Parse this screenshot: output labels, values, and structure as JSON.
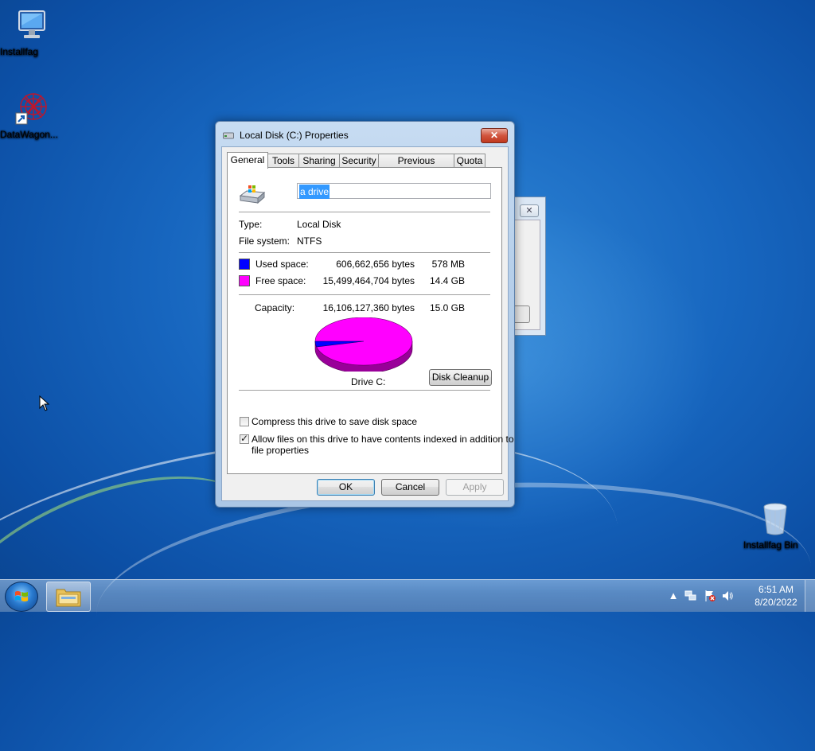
{
  "desktop": {
    "icons": [
      {
        "label": "Installfag",
        "icon": "computer-monitor-icon"
      },
      {
        "label": "DataWagon...",
        "icon": "shortcut-app-icon"
      },
      {
        "label": "Installfag Bin",
        "icon": "recycle-bin-icon"
      }
    ]
  },
  "dialog": {
    "title": "Local Disk (C:) Properties",
    "close_label": "✕",
    "tabs": [
      "General",
      "Tools",
      "Sharing",
      "Security",
      "Previous Versions",
      "Quota"
    ],
    "active_tab": "General",
    "drive_name": "a drive",
    "type_label": "Type:",
    "type_value": "Local Disk",
    "fs_label": "File system:",
    "fs_value": "NTFS",
    "used": {
      "label": "Used space:",
      "bytes": "606,662,656 bytes",
      "size": "578 MB",
      "color": "#0000ff"
    },
    "free": {
      "label": "Free space:",
      "bytes": "15,499,464,704 bytes",
      "size": "14.4 GB",
      "color": "#ff00ff"
    },
    "capacity": {
      "label": "Capacity:",
      "bytes": "16,106,127,360 bytes",
      "size": "15.0 GB"
    },
    "drive_caption": "Drive C:",
    "disk_cleanup_label": "Disk Cleanup",
    "compress_label": "Compress this drive to save disk space",
    "compress_checked": false,
    "index_label_line1": "Allow files on this drive to have contents indexed in addition to",
    "index_label_line2": "file properties",
    "index_checked": true,
    "ok_label": "OK",
    "cancel_label": "Cancel",
    "apply_label": "Apply"
  },
  "taskbar": {
    "time": "6:51 AM",
    "date": "8/20/2022"
  }
}
